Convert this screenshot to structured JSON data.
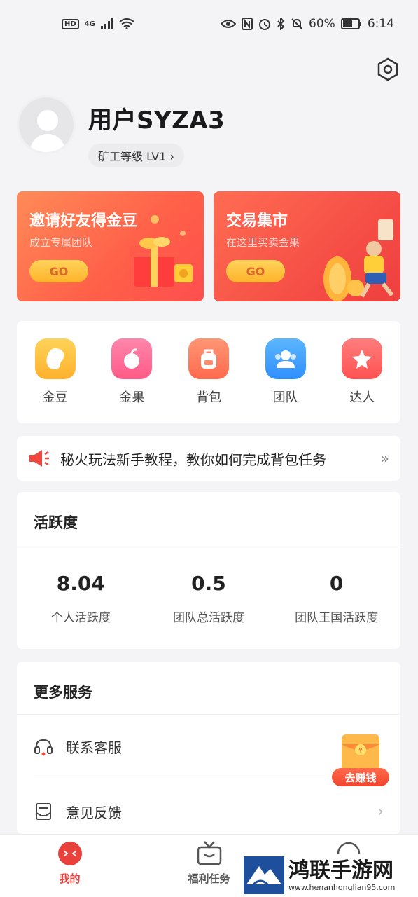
{
  "status_bar": {
    "hd": "HD",
    "network": "4G",
    "battery": "60%",
    "time": "6:14"
  },
  "profile": {
    "username": "用户SYZA3",
    "level": "矿工等级 LV1 ›"
  },
  "promos": [
    {
      "title": "邀请好友得金豆",
      "subtitle": "成立专属团队",
      "button": "GO"
    },
    {
      "title": "交易集市",
      "subtitle": "在这里买卖金果",
      "button": "GO"
    }
  ],
  "shortcuts": [
    {
      "label": "金豆",
      "icon": "bean-icon",
      "color": "#ffbf3c"
    },
    {
      "label": "金果",
      "icon": "fruit-icon",
      "color": "#ff6f9a"
    },
    {
      "label": "背包",
      "icon": "backpack-icon",
      "color": "#ff7c5e"
    },
    {
      "label": "团队",
      "icon": "team-icon",
      "color": "#3ea2ff"
    },
    {
      "label": "达人",
      "icon": "star-icon",
      "color": "#ff5f5f"
    }
  ],
  "notice": {
    "text": "秘火玩法新手教程，教你如何完成背包任务",
    "arrow": "»"
  },
  "activity": {
    "title": "活跃度",
    "stats": [
      {
        "value": "8.04",
        "label": "个人活跃度"
      },
      {
        "value": "0.5",
        "label": "团队总活跃度"
      },
      {
        "value": "0",
        "label": "团队王国活跃度"
      }
    ]
  },
  "services": {
    "title": "更多服务",
    "items": [
      {
        "label": "联系客服",
        "icon": "headset-icon"
      },
      {
        "label": "意见反馈",
        "icon": "feedback-icon"
      }
    ]
  },
  "float_button": {
    "label": "去赚钱"
  },
  "tabs": [
    {
      "label": "我的",
      "active": true
    },
    {
      "label": "福利任务",
      "active": false
    },
    {
      "label": "",
      "active": false
    }
  ],
  "watermark": {
    "title": "鸿联手游网",
    "url": "www.henanhonglian95.com"
  },
  "colors": {
    "accent": "#e8403a",
    "promo_orange": "#ff6a4a",
    "go_button": "#ffc340"
  }
}
